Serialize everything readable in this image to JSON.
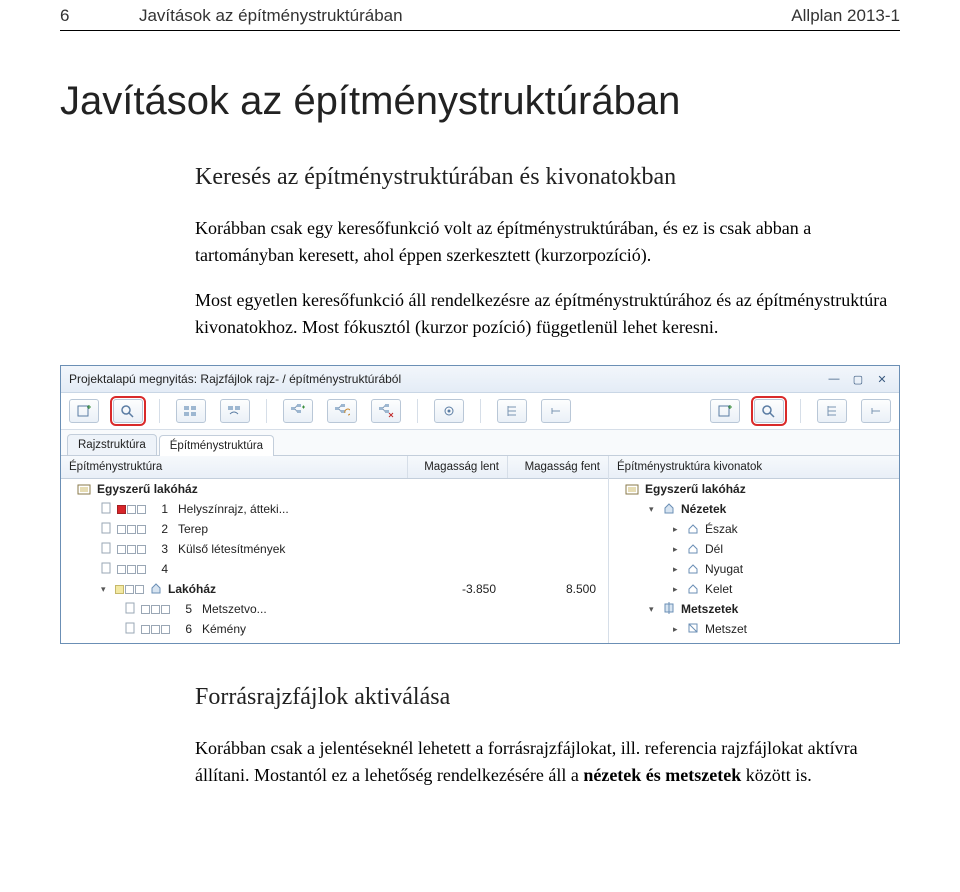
{
  "header": {
    "page_number_left": "6",
    "breadcrumb_title": "Javítások az építménystruktúrában",
    "right": "Allplan 2013-1"
  },
  "content": {
    "main_heading": "Javítások az építménystruktúrában",
    "sub_heading_1": "Keresés az építménystruktúrában és kivonatokban",
    "para_1": "Korábban csak egy keresőfunkció volt az építménystruktúrában, és ez is csak abban a tartományban keresett, ahol éppen szerkesztett (kurzorpozíció).",
    "para_2": "Most egyetlen keresőfunkció áll rendelkezésre az építménystruktúrához és az építménystruktúra kivonatokhoz. Most fókusztól (kurzor pozíció) függetlenül lehet keresni.",
    "sub_heading_2": "Forrásrajzfájlok aktiválása",
    "para_3_a": "Korábban csak a jelentéseknél lehetett a forrásrajzfájlokat, ill. referencia rajzfájlokat aktívra állítani. Mostantól ez a lehetőség rendelkezésére áll a ",
    "para_3_b": "nézetek és metszetek",
    "para_3_c": " között is."
  },
  "screenshot": {
    "window_title": "Projektalapú megnyitás: Rajzfájlok rajz- / építménystruktúrából",
    "tabs": {
      "tab1": "Rajzstruktúra",
      "tab2": "Építménystruktúra"
    },
    "columns": {
      "col_struct": "Építménystruktúra",
      "col_low": "Magasság lent",
      "col_high": "Magasság fent",
      "col_extract": "Építménystruktúra kivonatok"
    },
    "left_tree": {
      "root": "Egyszerű lakóház",
      "r1_num": "1",
      "r1_label": "Helyszínrajz, átteki...",
      "r2_num": "2",
      "r2_label": "Terep",
      "r3_num": "3",
      "r3_label": "Külső létesítmények",
      "r4_num": "4",
      "r4_label": "",
      "group_label": "Lakóház",
      "group_low": "-3.850",
      "group_high": "8.500",
      "r5_num": "5",
      "r5_label": "Metszetvo...",
      "r6_num": "6",
      "r6_label": "Kémény"
    },
    "right_tree": {
      "root": "Egyszerű lakóház",
      "nezetek": "Nézetek",
      "eszak": "Észak",
      "del": "Dél",
      "nyugat": "Nyugat",
      "kelet": "Kelet",
      "metszetek": "Metszetek",
      "metszet": "Metszet"
    }
  }
}
